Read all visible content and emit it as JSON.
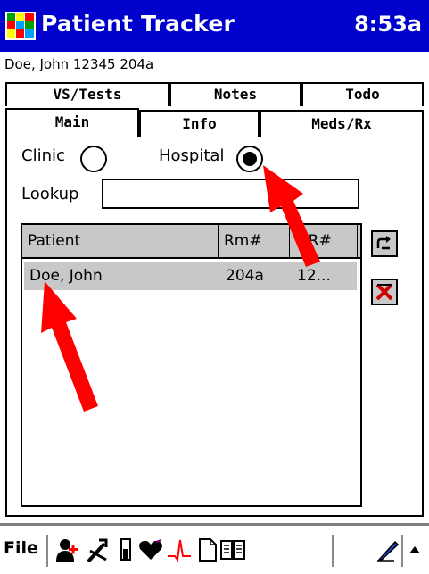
{
  "titlebar": {
    "title": "Patient Tracker",
    "time": "8:53a",
    "app_icon": "grid-app-icon"
  },
  "patient_line": "Doe, John 12345 204a",
  "tabs": {
    "back_row": [
      "VS/Tests",
      "Notes",
      "Todo"
    ],
    "front_row": [
      "Main",
      "Info",
      "Meds/Rx"
    ],
    "active": "Main"
  },
  "main": {
    "clinic_label": "Clinic",
    "hospital_label": "Hospital",
    "selected_location": "Hospital",
    "lookup_label": "Lookup",
    "lookup_value": ""
  },
  "list": {
    "columns": [
      "Patient",
      "Rm#",
      "MR#"
    ],
    "rows": [
      {
        "patient": "Doe, John",
        "room": "204a",
        "mr": "12..."
      }
    ]
  },
  "side_buttons": [
    "refresh-icon",
    "delete-icon"
  ],
  "toolbar": {
    "file_label": "File",
    "icons": [
      "add-patient-icon",
      "procedure-icon",
      "test-tube-icon",
      "heart-icon",
      "ekg-icon",
      "document-icon",
      "book-icon",
      "pen-icon",
      "up-arrow-icon"
    ]
  },
  "colors": {
    "title_bar": "#0000cc",
    "row_highlight": "#c8c8c8",
    "annotation_arrow": "#ff0000"
  }
}
